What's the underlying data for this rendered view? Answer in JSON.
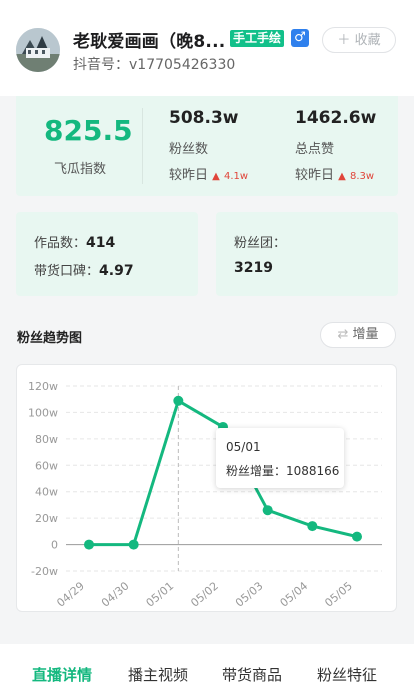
{
  "profile": {
    "name": "老耿爱画画（晚8...",
    "tag": "手工手绘",
    "gender_icon": "♂",
    "favorite_label": "收藏",
    "douyin_id": "抖音号：v17705426330"
  },
  "stats": {
    "score": "825.5",
    "score_label": "飞瓜指数",
    "fans_value": "508.3w",
    "fans_label": "粉丝数",
    "fans_compare_label": "较昨日",
    "fans_compare_value": "4.1w",
    "likes_value": "1462.6w",
    "likes_label": "总点赞",
    "likes_compare_label": "较昨日",
    "likes_compare_value": "8.3w"
  },
  "details": {
    "works_label": "作品数：",
    "works_value": "414",
    "reputation_label": "带货口碑：",
    "reputation_value": "4.97",
    "fan_group_label": "粉丝团：",
    "fan_group_value": "3219"
  },
  "trend": {
    "title": "粉丝趋势图",
    "toggle_label": "增量",
    "tooltip_date": "05/01",
    "tooltip_text": "粉丝增量：1088166"
  },
  "chart_data": {
    "type": "line",
    "categories": [
      "04/29",
      "04/30",
      "05/01",
      "05/02",
      "05/03",
      "05/04",
      "05/05"
    ],
    "series": [
      {
        "values": [
          0,
          0,
          108.8,
          89,
          26,
          14,
          6
        ]
      }
    ],
    "yticks": [
      "120w",
      "100w",
      "80w",
      "60w",
      "40w",
      "20w",
      "0",
      "-20w"
    ],
    "ylim": [
      -20,
      120
    ],
    "color": "#14b87f"
  },
  "tabs": [
    "直播详情",
    "播主视频",
    "带货商品",
    "粉丝特征"
  ],
  "colors": {
    "accent": "#14b87f",
    "up": "#e0453a"
  }
}
